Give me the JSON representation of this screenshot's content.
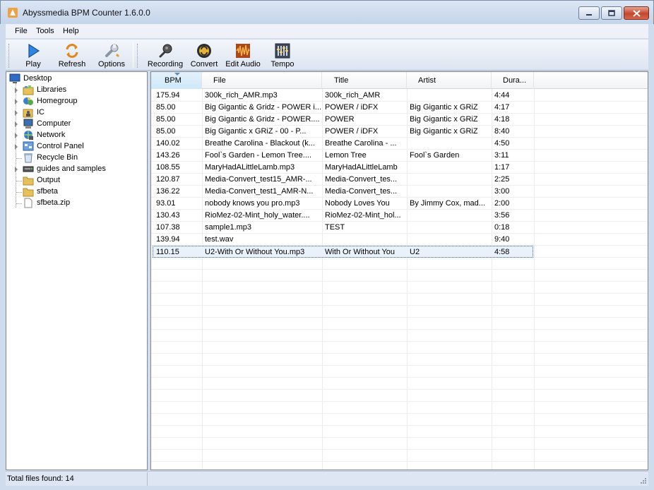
{
  "window": {
    "title": "Abyssmedia BPM Counter 1.6.0.0"
  },
  "menu": [
    "File",
    "Tools",
    "Help"
  ],
  "toolbar": {
    "play": "Play",
    "refresh": "Refresh",
    "options": "Options",
    "recording": "Recording",
    "convert": "Convert",
    "edit_audio": "Edit Audio",
    "tempo": "Tempo"
  },
  "tree": [
    {
      "label": "Desktop",
      "icon": "desktop-icon"
    },
    {
      "label": "Libraries",
      "icon": "libraries-icon"
    },
    {
      "label": "Homegroup",
      "icon": "homegroup-icon"
    },
    {
      "label": "IC",
      "icon": "user-folder-icon"
    },
    {
      "label": "Computer",
      "icon": "computer-icon"
    },
    {
      "label": "Network",
      "icon": "network-icon"
    },
    {
      "label": "Control Panel",
      "icon": "control-panel-icon"
    },
    {
      "label": "Recycle Bin",
      "icon": "recycle-bin-icon"
    },
    {
      "label": "guides and samples",
      "icon": "drive-icon"
    },
    {
      "label": "Output",
      "icon": "folder-icon"
    },
    {
      "label": "sfbeta",
      "icon": "folder-icon"
    },
    {
      "label": "sfbeta.zip",
      "icon": "file-icon"
    }
  ],
  "columns": [
    "BPM",
    "File",
    "Title",
    "Artist",
    "Dura..."
  ],
  "rows": [
    [
      "175.94",
      "300k_rich_AMR.mp3",
      "300k_rich_AMR",
      "",
      "4:44"
    ],
    [
      "85.00",
      "Big Gigantic & Gridz - POWER i...",
      "POWER  / iDFX",
      "Big Gigantic x GRiZ",
      "4:17"
    ],
    [
      "85.00",
      "Big Gigantic & Gridz - POWER....",
      "POWER",
      "Big Gigantic x GRiZ",
      "4:18"
    ],
    [
      "85.00",
      "Big Gigantic x GRiZ  -  00 - P...",
      "POWER  / iDFX",
      "Big Gigantic x GRiZ",
      "8:40"
    ],
    [
      "140.02",
      "Breathe Carolina - Blackout (k...",
      "Breathe Carolina - ...",
      "",
      "4:50"
    ],
    [
      "143.26",
      "Fool`s Garden - Lemon Tree....",
      "Lemon Tree",
      "Fool`s Garden",
      "3:11"
    ],
    [
      "108.55",
      "MaryHadALittleLamb.mp3",
      "MaryHadALittleLamb",
      "",
      "1:17"
    ],
    [
      "120.87",
      "Media-Convert_test15_AMR-...",
      "Media-Convert_tes...",
      "",
      "2:25"
    ],
    [
      "136.22",
      "Media-Convert_test1_AMR-N...",
      "Media-Convert_tes...",
      "",
      "3:00"
    ],
    [
      "93.01",
      "nobody knows you pro.mp3",
      "Nobody Loves You",
      "By Jimmy Cox, mad...",
      "2:00"
    ],
    [
      "130.43",
      "RioMez-02-Mint_holy_water....",
      "RioMez-02-Mint_hol...",
      "",
      "3:56"
    ],
    [
      "107.38",
      "sample1.mp3",
      "TEST",
      "",
      "0:18"
    ],
    [
      "139.94",
      "test.wav",
      "",
      "",
      "9:40"
    ],
    [
      "110.15",
      "U2-With Or Without You.mp3",
      "With Or Without You",
      "U2",
      "4:58"
    ]
  ],
  "selected_row": 13,
  "status": {
    "text": "Total files found: 14"
  }
}
